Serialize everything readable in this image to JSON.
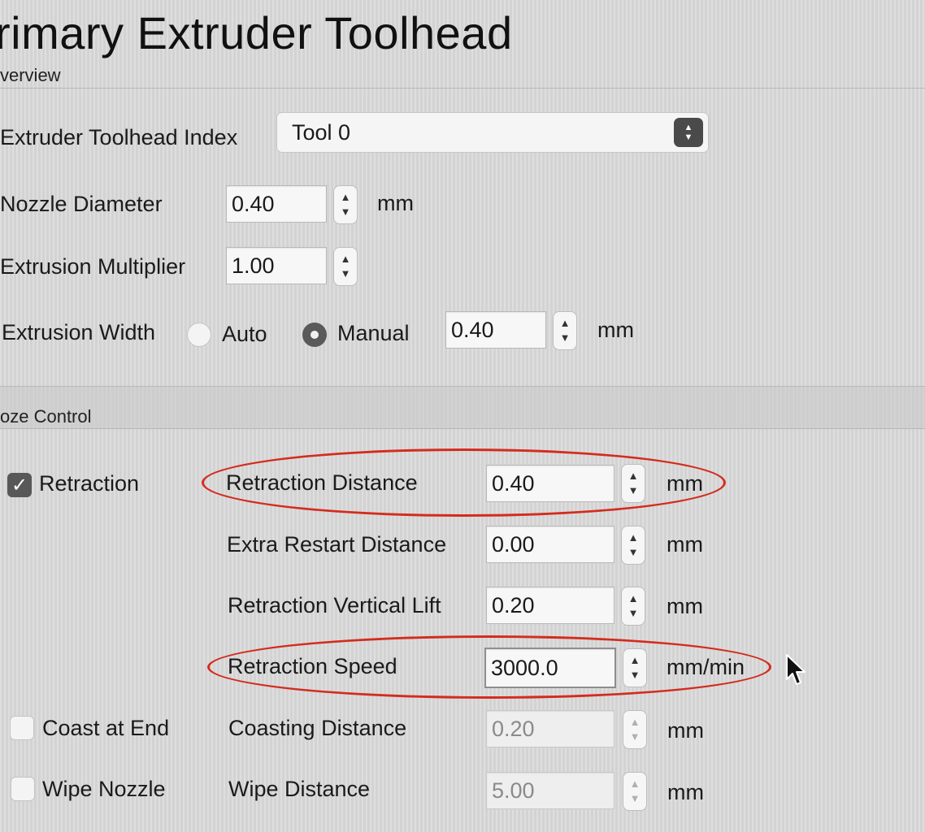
{
  "window": {
    "title": "rimary Extruder Toolhead",
    "section_overview": "verview",
    "section_ooze": "oze Control"
  },
  "overview": {
    "toolhead_index": {
      "label": "Extruder Toolhead Index",
      "value": "Tool 0"
    },
    "nozzle_diameter": {
      "label": "Nozzle Diameter",
      "value": "0.40",
      "unit": "mm"
    },
    "extrusion_multiplier": {
      "label": "Extrusion Multiplier",
      "value": "1.00"
    },
    "extrusion_width": {
      "label": "Extrusion Width",
      "option_auto": "Auto",
      "option_manual": "Manual",
      "selected": "Manual",
      "value": "0.40",
      "unit": "mm"
    }
  },
  "ooze": {
    "retraction": {
      "label": "Retraction",
      "checked": true,
      "distance": {
        "label": "Retraction Distance",
        "value": "0.40",
        "unit": "mm"
      },
      "extra_restart": {
        "label": "Extra Restart Distance",
        "value": "0.00",
        "unit": "mm"
      },
      "vertical_lift": {
        "label": "Retraction Vertical Lift",
        "value": "0.20",
        "unit": "mm"
      },
      "speed": {
        "label": "Retraction Speed",
        "value": "3000.0",
        "unit": "mm/min"
      }
    },
    "coast": {
      "label": "Coast at End",
      "checked": false,
      "distance": {
        "label": "Coasting Distance",
        "value": "0.20",
        "unit": "mm"
      }
    },
    "wipe": {
      "label": "Wipe Nozzle",
      "checked": false,
      "distance": {
        "label": "Wipe Distance",
        "value": "5.00",
        "unit": "mm"
      }
    }
  },
  "icons": {
    "check": "✓",
    "stepper_up": "▲",
    "stepper_down": "▼",
    "cursor": "arrow-cursor-icon"
  },
  "colors": {
    "annotation_red": "#d42b1e",
    "background": "#dadada",
    "control_dark": "#585858"
  }
}
